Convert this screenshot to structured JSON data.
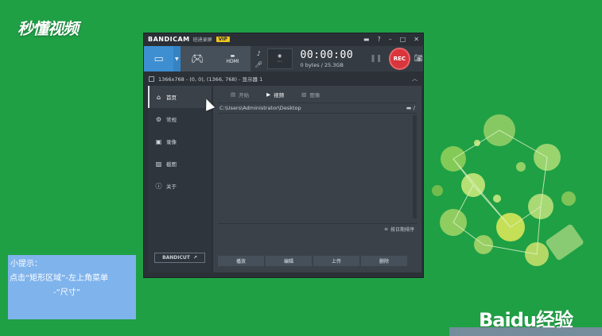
{
  "watermark_top": "秒懂视频",
  "window": {
    "brand": "BANDICAM",
    "brand_sub": "班迪录屏",
    "vip": "VIP",
    "title_icons": [
      "folder-icon",
      "help-icon",
      "minimize-icon",
      "maximize-icon",
      "close-icon"
    ],
    "timer": "00:00:00",
    "size": "0 bytes / 25.3GB",
    "rec_label": "REC",
    "hdmi_label": "HDMI",
    "area_label": "1366x768 - (0, 0), (1366, 768) - 显示器 1",
    "nav": [
      {
        "label": "首页",
        "icon": "home-icon"
      },
      {
        "label": "常规",
        "icon": "gear-icon"
      },
      {
        "label": "录像",
        "icon": "video-icon"
      },
      {
        "label": "截图",
        "icon": "image-icon"
      },
      {
        "label": "关于",
        "icon": "info-icon"
      }
    ],
    "bandicut": "BANDICUT",
    "tabs": [
      {
        "label": "开始",
        "icon": "film-icon"
      },
      {
        "label": "视频",
        "icon": "play-icon"
      },
      {
        "label": "图像",
        "icon": "picture-icon"
      }
    ],
    "path": "C:\\Users\\Administrator\\Desktop",
    "sort_label": "按日期排序",
    "buttons": [
      "播放",
      "编辑",
      "上传",
      "删除"
    ]
  },
  "tip": {
    "line1": "小提示：",
    "line2": "点击“矩形区域”-左上角菜单",
    "line3": "-“尺寸”"
  },
  "baidu_logo": "Baidu经验",
  "colors": {
    "background": "#1fa045",
    "accent_blue": "#3d8fd1",
    "rec_red": "#d9353c",
    "tip_box": "#7fb3ec"
  }
}
